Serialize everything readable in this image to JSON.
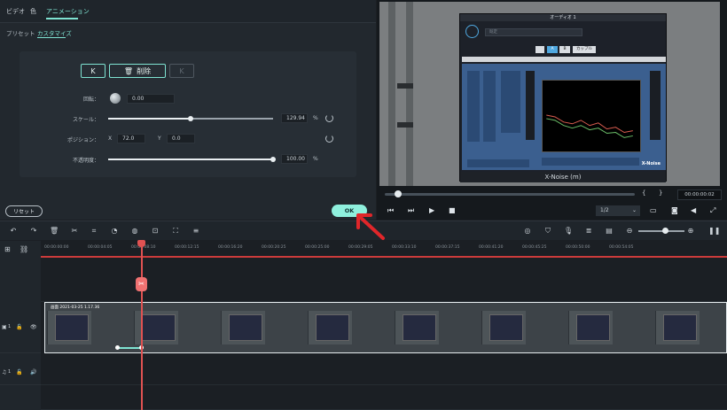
{
  "editor_tabs": [
    "ビデオ",
    "色",
    "アニメーション"
  ],
  "sub_tabs": [
    "プリセット",
    "カスタマイズ"
  ],
  "keyframe": {
    "prev_label": "K",
    "delete_label": "削除",
    "next_label": "K"
  },
  "properties": {
    "rotation_label": "回転：",
    "rotation_value": "0.00",
    "scale_label": "スケール：",
    "scale_value": "129.94",
    "scale_unit": "%",
    "scale_level_percent": 50,
    "position_label": "ポジション：",
    "position_x_label": "X",
    "position_x_value": "72.0",
    "position_y_label": "Y",
    "position_y_value": "0.0",
    "opacity_label": "不透明度：",
    "opacity_value": "100.00",
    "opacity_unit": "%",
    "opacity_level_percent": 100
  },
  "buttons": {
    "reset_label": "リセット",
    "ok_label": "OK"
  },
  "preview": {
    "plugin_title": "オーディオ 1",
    "plugin_preset": "既定",
    "plugin_btn_a": "A",
    "plugin_btn_b": "B",
    "plugin_btn_compare": "カップル",
    "plugin_name": "X-Noise (m)",
    "plugin_brand": "X-Noise",
    "timecode": "00:00:00:02",
    "ratio": "1/2"
  },
  "timeline": {
    "ruler_ticks": [
      "00:00:00:00",
      "00:00:04:05",
      "00:00:08:10",
      "00:00:12:15",
      "00:00:16:20",
      "00:00:20:25",
      "00:00:25:00",
      "00:00:29:05",
      "00:00:33:10",
      "00:00:37:15",
      "00:00:41:20",
      "00:00:45:25",
      "00:00:50:00",
      "00:00:54:05"
    ],
    "clip_label": "画面 2021-03-25 1.17.36",
    "video_track_label": "1",
    "audio_track_label": "1"
  },
  "colors": {
    "accent": "#7fe3d2",
    "ok_button": "#8ff0dd",
    "playhead": "#e05252",
    "annotation_arrow": "#e0262a"
  }
}
